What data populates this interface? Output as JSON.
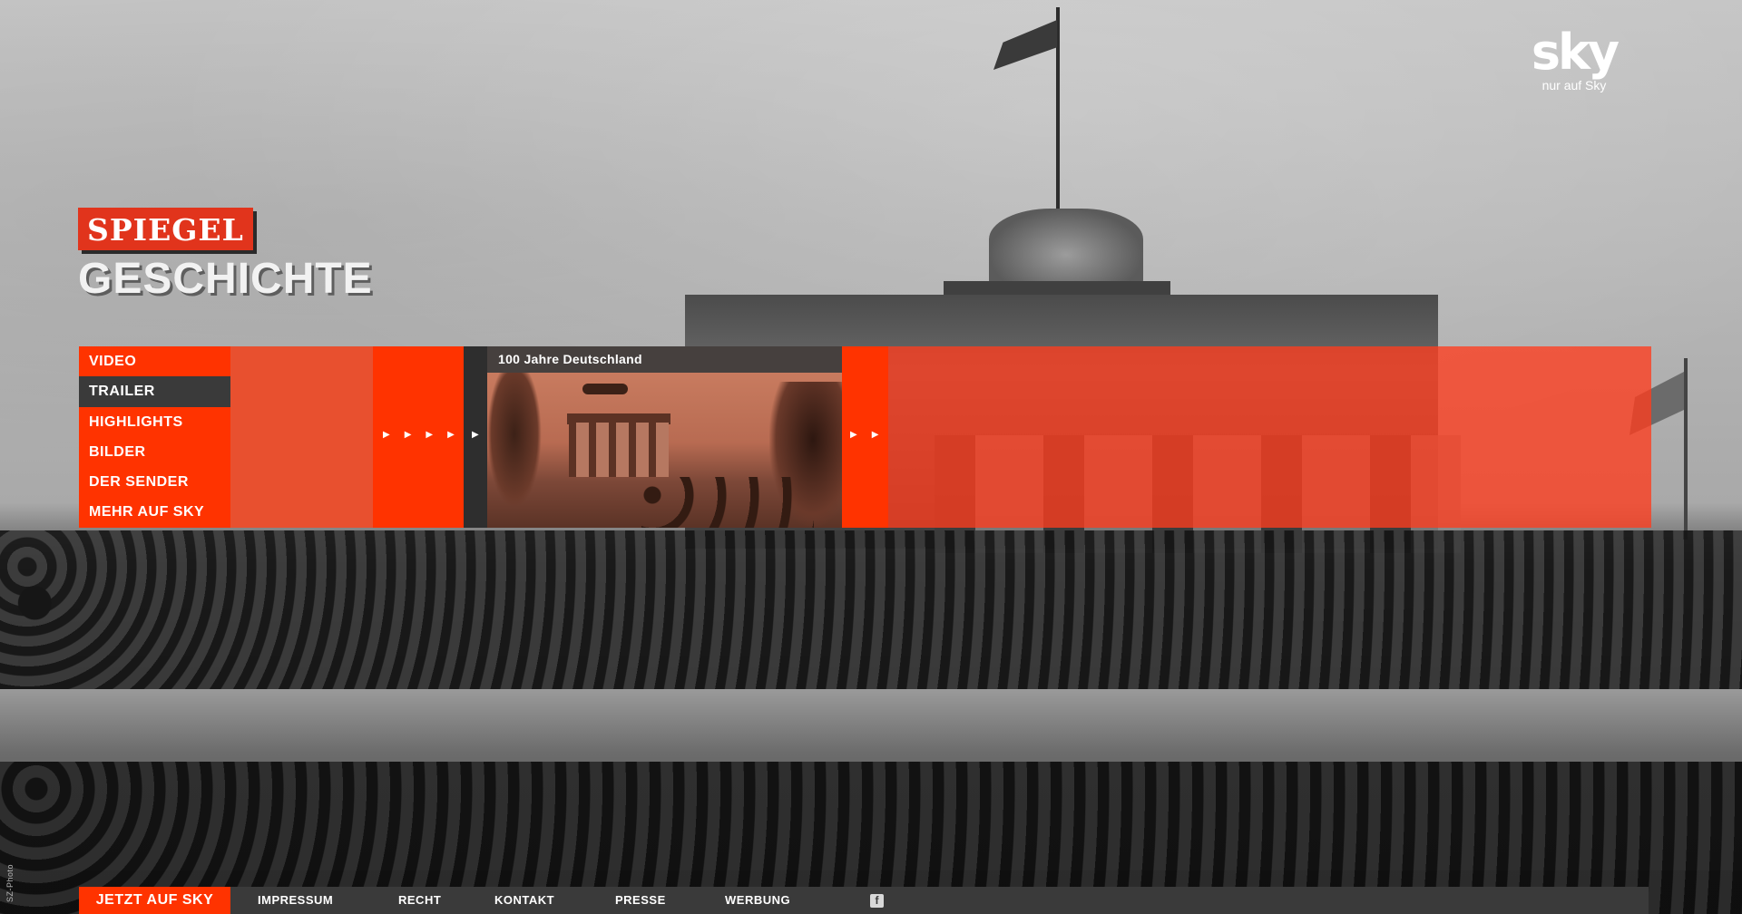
{
  "branding": {
    "sky_wordmark": "sky",
    "sky_tagline": "nur auf Sky",
    "spiegel": "SPIEGEL",
    "geschichte": "GESCHICHTE"
  },
  "menu": {
    "items": [
      {
        "label": "VIDEO"
      },
      {
        "label": "TRAILER"
      },
      {
        "label": "HIGHLIGHTS"
      },
      {
        "label": "BILDER"
      },
      {
        "label": "DER SENDER"
      },
      {
        "label": "MEHR AUF SKY"
      }
    ],
    "active": "TRAILER"
  },
  "video": {
    "title": "100 Jahre Deutschland"
  },
  "footer": {
    "cta": "JETZT AUF SKY",
    "links": [
      {
        "label": "IMPRESSUM"
      },
      {
        "label": "RECHT"
      },
      {
        "label": "KONTAKT"
      },
      {
        "label": "PRESSE"
      },
      {
        "label": "WERBUNG"
      }
    ],
    "facebook_icon": "f"
  },
  "photo_credit": "SZ-Photo",
  "colors": {
    "accent": "#ff3300",
    "dark": "#3a3a3a"
  }
}
